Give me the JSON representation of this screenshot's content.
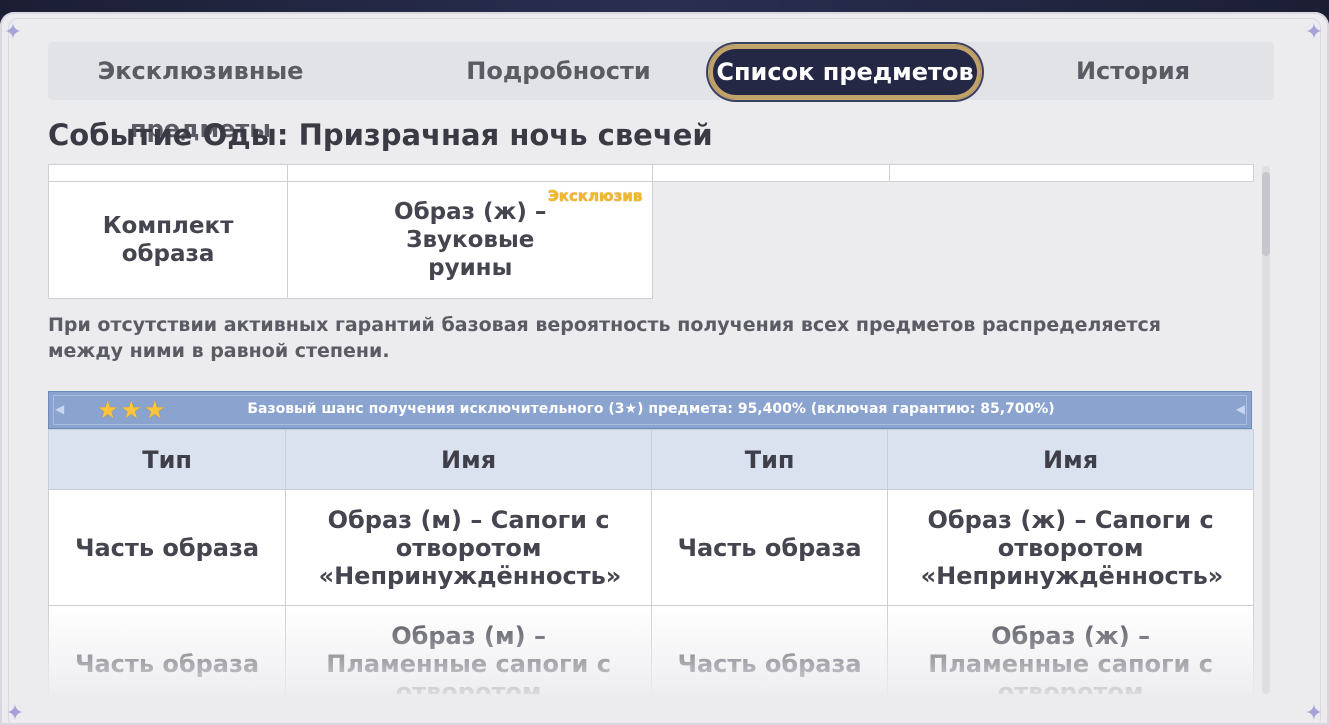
{
  "tabs": [
    {
      "label": "Эксклюзивные предметы"
    },
    {
      "label": "Подробности"
    },
    {
      "label": "Список предметов",
      "active": true
    },
    {
      "label": "История"
    }
  ],
  "page_title": "Событие Оды: Призрачная ночь свечей",
  "top_table": {
    "row": {
      "type": "Комплект образа",
      "name": "Образ (ж) – Звуковые руины",
      "badge": "Эксклюзив"
    }
  },
  "note": "При отсутствии активных гарантий базовая вероятность получения всех предметов распределяется между ними в равной степени.",
  "banner": {
    "stars": "★★★",
    "text": "Базовый шанс получения исключительного (3★) предмета: 95,400% (включая гарантию: 85,700%)"
  },
  "main_table": {
    "headers": [
      "Тип",
      "Имя",
      "Тип",
      "Имя"
    ],
    "rows": [
      [
        "Часть образа",
        "Образ (м) – Сапоги с отворотом «Непринуждённость»",
        "Часть образа",
        "Образ (ж) – Сапоги с отворотом «Непринуждённость»"
      ],
      [
        "Часть образа",
        "Образ (м) – Пламенные сапоги с отворотом",
        "Часть образа",
        "Образ (ж) – Пламенные сапоги с отворотом"
      ]
    ]
  },
  "colors": {
    "active_tab_bg": "#242845",
    "banner_bg": "#8aa3cf",
    "header_bg": "#dbe2ef",
    "badge_gold": "#f3b82a"
  },
  "icons": {
    "corner": "sparkle-icon",
    "star": "star-icon"
  }
}
